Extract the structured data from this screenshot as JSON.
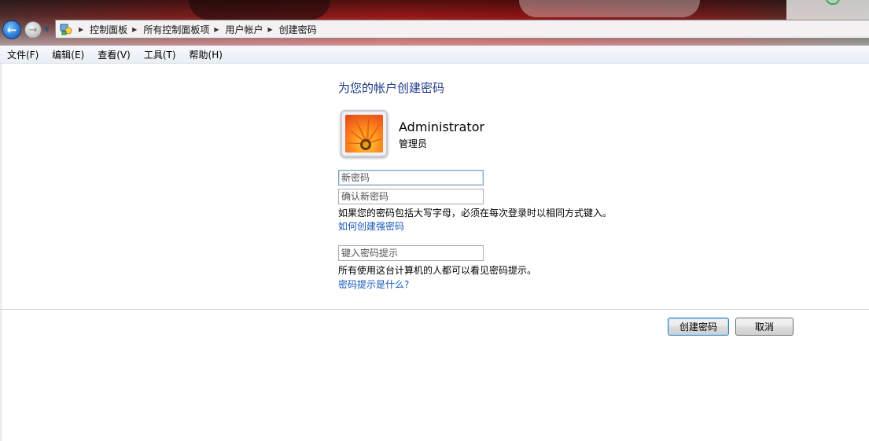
{
  "navigation": {
    "back_icon": "back-arrow-icon",
    "forward_icon": "forward-arrow-icon",
    "breadcrumb": [
      "控制面板",
      "所有控制面板项",
      "用户帐户",
      "创建密码"
    ]
  },
  "menu": [
    "文件(F)",
    "编辑(E)",
    "查看(V)",
    "工具(T)",
    "帮助(H)"
  ],
  "page": {
    "title": "为您的帐户创建密码",
    "user": {
      "name": "Administrator",
      "role": "管理员"
    },
    "new_password_placeholder": "新密码",
    "confirm_password_placeholder": "确认新密码",
    "case_note": "如果您的密码包括大写字母，必须在每次登录时以相同方式键入。",
    "strong_password_link": "如何创建强密码",
    "hint_placeholder": "键入密码提示",
    "hint_note": "所有使用这台计算机的人都可以看见密码提示。",
    "hint_link": "密码提示是什么?"
  },
  "buttons": {
    "create": "创建密码",
    "cancel": "取消"
  },
  "colors": {
    "title": "#1e3a8a",
    "link": "#1556b5",
    "primary_border": "#3c7fb1"
  }
}
